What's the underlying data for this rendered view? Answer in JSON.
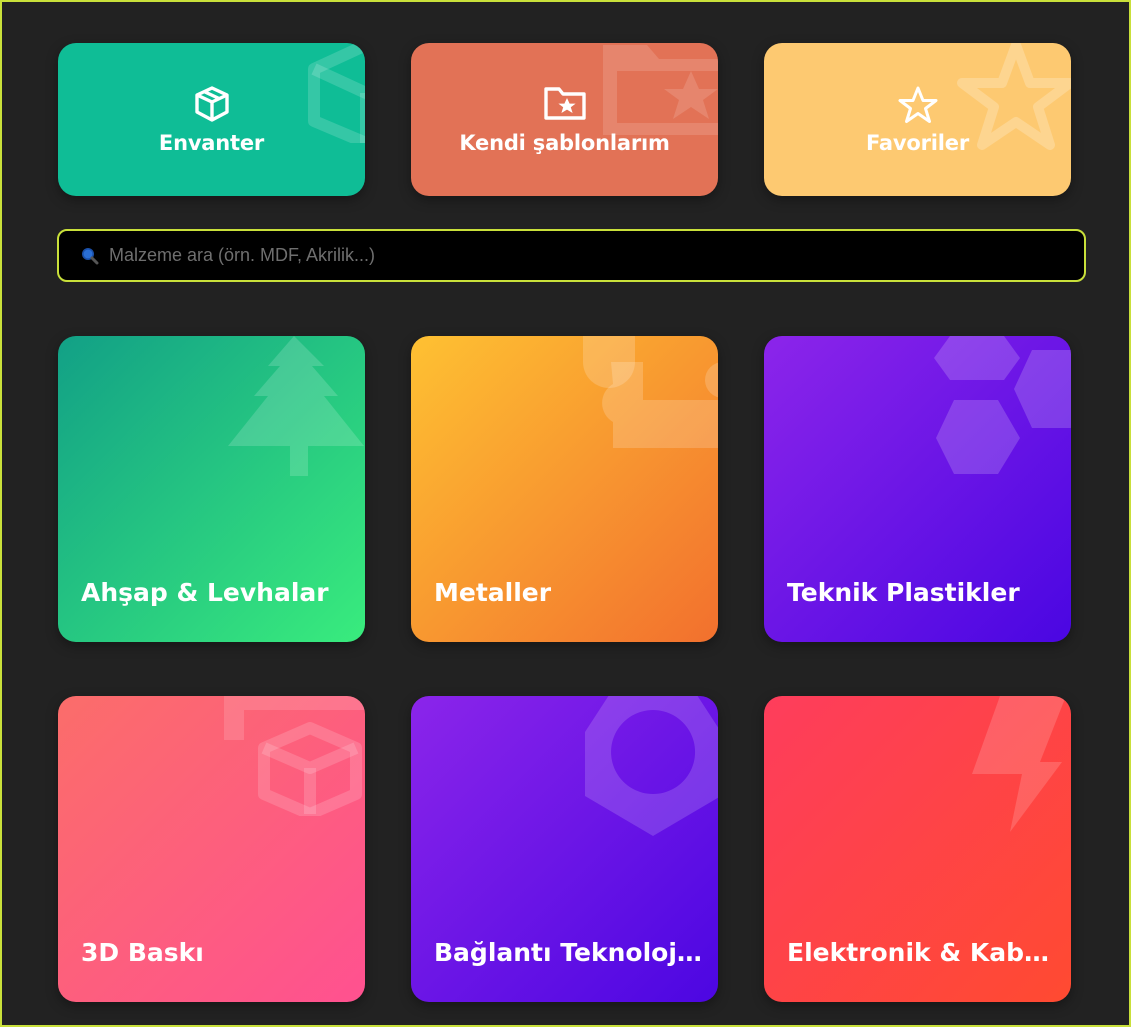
{
  "quick_actions": [
    {
      "label": "Envanter",
      "icon": "box-icon",
      "color": "#0fbd96"
    },
    {
      "label": "Kendi şablonlarım",
      "icon": "folder-star-icon",
      "color": "#e27256"
    },
    {
      "label": "Favoriler",
      "icon": "star-icon",
      "color": "#fdc971"
    }
  ],
  "search": {
    "placeholder": "Malzeme ara (örn. MDF, Akrilik...)",
    "value": "",
    "icon": "search-icon"
  },
  "categories": [
    {
      "label": "Ahşap & Levhalar",
      "icon": "tree-icon",
      "gradient": [
        "#12a086",
        "#39ec7d"
      ]
    },
    {
      "label": "Metaller",
      "icon": "wrench-icon",
      "gradient": [
        "#fec132",
        "#f2702e"
      ]
    },
    {
      "label": "Teknik Plastikler",
      "icon": "hexagons-icon",
      "gradient": [
        "#8c25ea",
        "#4a06e2"
      ]
    },
    {
      "label": "3D Baskı",
      "icon": "cube-icon",
      "gradient": [
        "#fb6d6a",
        "#ff5190"
      ]
    },
    {
      "label": "Bağlantı Teknoloji...",
      "icon": "nut-icon",
      "gradient": [
        "#8b25ea",
        "#4c06e2"
      ]
    },
    {
      "label": "Elektronik & Kabl...",
      "icon": "lightning-icon",
      "gradient": [
        "#fe3d5c",
        "#ff4a31"
      ]
    }
  ],
  "colors": {
    "background": "#222222",
    "accent_border": "#c9e03a",
    "search_bg": "#000000"
  }
}
